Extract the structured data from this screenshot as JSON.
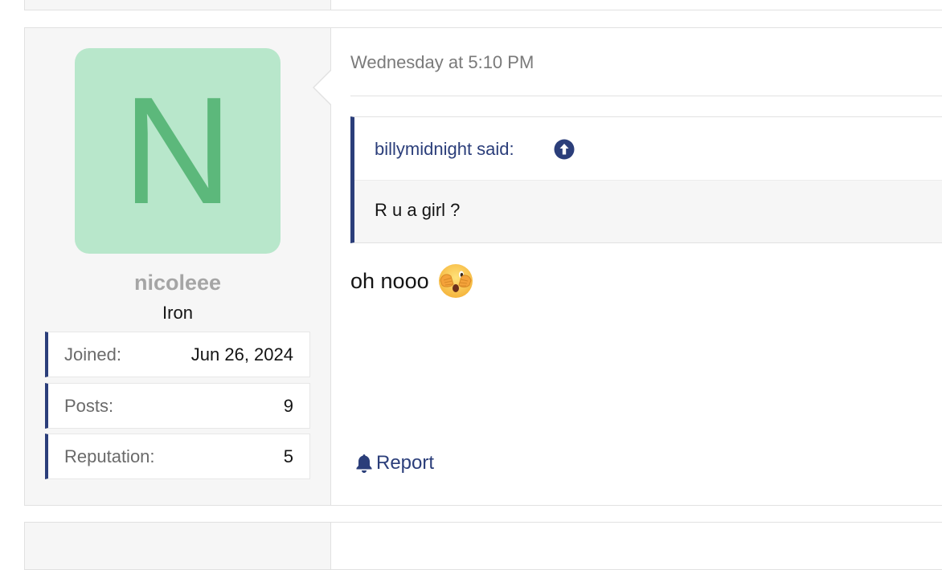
{
  "previous_post": {},
  "post": {
    "user": {
      "avatar_letter": "N",
      "avatar_bg": "#b8e7cb",
      "avatar_fg": "#5cb87b",
      "username": "nicoleee",
      "title": "Iron",
      "stats": {
        "joined_label": "Joined:",
        "joined_value": "Jun 26, 2024",
        "posts_label": "Posts:",
        "posts_value": "9",
        "reputation_label": "Reputation:",
        "reputation_value": "5"
      }
    },
    "date": "Wednesday at 5:10 PM",
    "quote": {
      "author_line": "billymidnight said:",
      "jump_icon": "arrow-up-circle-icon",
      "text": "R u a girl ?"
    },
    "message": {
      "text": "oh nooo",
      "emoji_icon": "face-with-open-eyes-and-hand-over-mouth-icon"
    },
    "report_label": "Report",
    "report_icon": "bell-icon",
    "accent_color": "#2b3e7a"
  }
}
